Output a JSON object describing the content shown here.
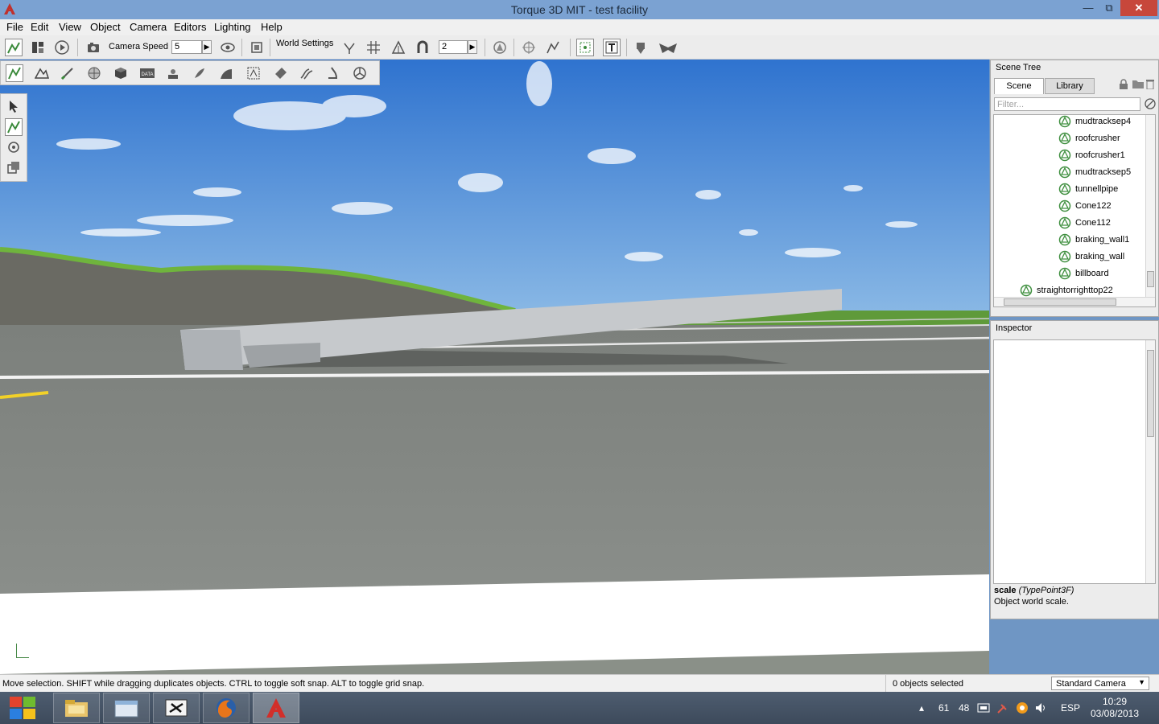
{
  "window": {
    "title": "Torque 3D MIT - test facility",
    "minimize_glyph": "—",
    "maximize_glyph": "⧉",
    "close_glyph": "✕"
  },
  "menu": [
    "File",
    "Edit",
    "View",
    "Object",
    "Camera",
    "Editors",
    "Lighting",
    "Help"
  ],
  "toolbar": {
    "camera_speed_label": "Camera Speed",
    "camera_speed_value": "5",
    "world_settings_label": "World Settings",
    "grid_snap_value": "2",
    "spin_glyph": "▶"
  },
  "scene_tree": {
    "header": "Scene Tree",
    "tabs": [
      "Scene",
      "Library"
    ],
    "filter_placeholder": "Filter...",
    "items": [
      "mudtracksep4",
      "roofcrusher",
      "roofcrusher1",
      "mudtracksep5",
      "tunnellpipe",
      "Cone122",
      "Cone112",
      "braking_wall1",
      "braking_wall",
      "billboard"
    ],
    "parent_item": "straightorrighttop22"
  },
  "inspector": {
    "header": "Inspector",
    "help_field": "scale",
    "help_type": "(TypePoint3F)",
    "help_description": "Object world scale."
  },
  "status": {
    "message": "Move selection.  SHIFT while dragging duplicates objects.  CTRL to toggle soft snap.  ALT to toggle grid snap.",
    "selection": "0 objects selected",
    "camera_mode": "Standard Camera",
    "dropdown_glyph": "▼"
  },
  "taskbar": {
    "tray_numbers": [
      "61",
      "48"
    ],
    "language": "ESP",
    "time": "10:29",
    "date": "03/08/2013",
    "up_glyph": "▴"
  },
  "colors": {
    "sky": "#3f86d9",
    "asphalt": "#878b87",
    "accent_red": "#c7473b",
    "tree_icon": "#3f8f3f"
  }
}
